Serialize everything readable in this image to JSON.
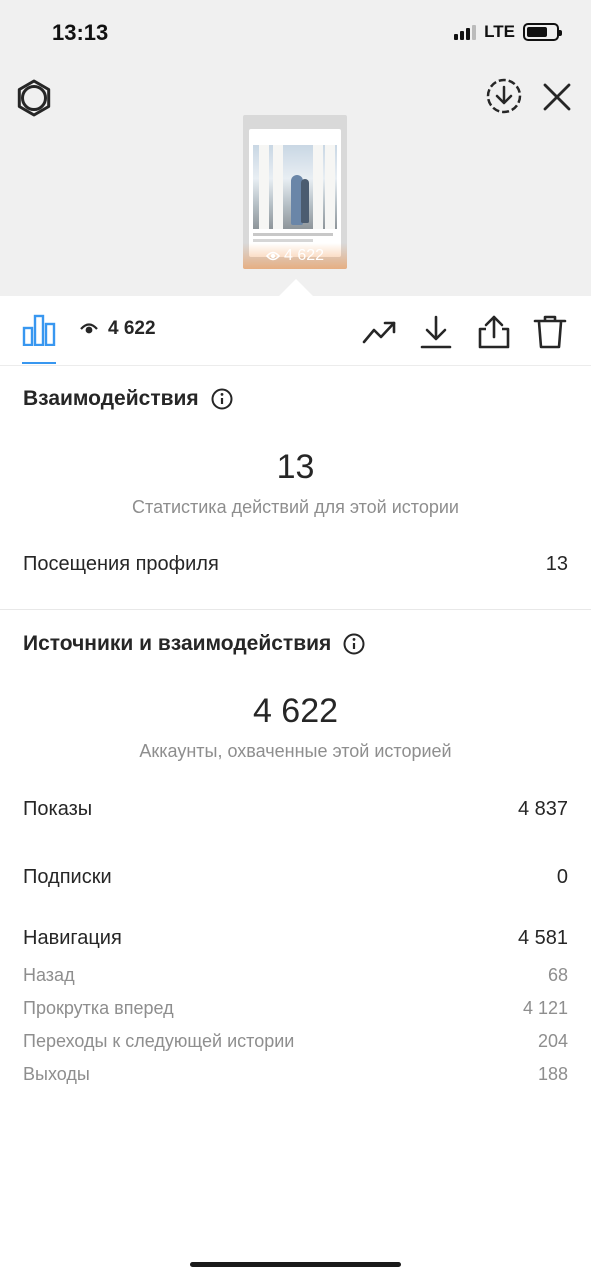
{
  "status_bar": {
    "time": "13:13",
    "network": "LTE"
  },
  "story": {
    "views": "4 622"
  },
  "tabbar": {
    "reach_count": "4 622"
  },
  "interactions": {
    "title": "Взаимодействия",
    "total": "13",
    "subtitle": "Статистика действий для этой истории",
    "rows": [
      {
        "label": "Посещения профиля",
        "value": "13"
      }
    ]
  },
  "sources": {
    "title": "Источники и взаимодействия",
    "total": "4 622",
    "subtitle": "Аккаунты, охваченные этой историей",
    "impressions": {
      "label": "Показы",
      "value": "4 837"
    },
    "follows": {
      "label": "Подписки",
      "value": "0"
    },
    "navigation": {
      "label": "Навигация",
      "value": "4 581"
    },
    "navigation_breakdown": [
      {
        "label": "Назад",
        "value": "68"
      },
      {
        "label": "Прокрутка вперед",
        "value": "4 121"
      },
      {
        "label": "Переходы к следующей истории",
        "value": "204"
      },
      {
        "label": "Выходы",
        "value": "188"
      }
    ]
  },
  "icons": {
    "settings": "gear-icon",
    "download_circle": "download-circle-icon",
    "close": "close-icon",
    "stats": "bar-chart-icon",
    "eye": "eye-icon",
    "trend": "trending-icon",
    "download": "download-icon",
    "share": "share-icon",
    "delete": "trash-icon",
    "info": "info-icon"
  },
  "colors": {
    "accent": "#3897f0",
    "text": "#262626",
    "secondary": "#8e8e8e",
    "header_bg": "#f0f0f0"
  }
}
